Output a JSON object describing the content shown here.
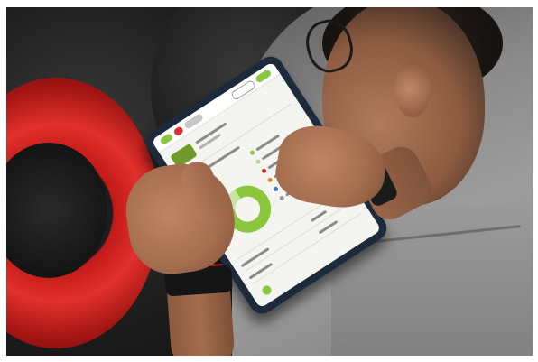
{
  "scene": {
    "description_subject": "",
    "colors": {
      "rim_red": "#e2302c",
      "tablet_frame": "#1d2a3c",
      "screen_bg": "#f4f5f1",
      "accent_green": "#8bc63f",
      "shirt_grey": "#8b8b8b"
    },
    "icons": {
      "tablet": "tablet-icon",
      "watch": "watch-icon",
      "wheel": "wheel-icon"
    }
  },
  "tablet_ui": {
    "colors": {
      "brand_green": "#8bc63f",
      "brand_red": "#d8302b",
      "text_grey": "#8a8a8a"
    },
    "donut": {
      "primary_fraction": 0.83
    }
  }
}
